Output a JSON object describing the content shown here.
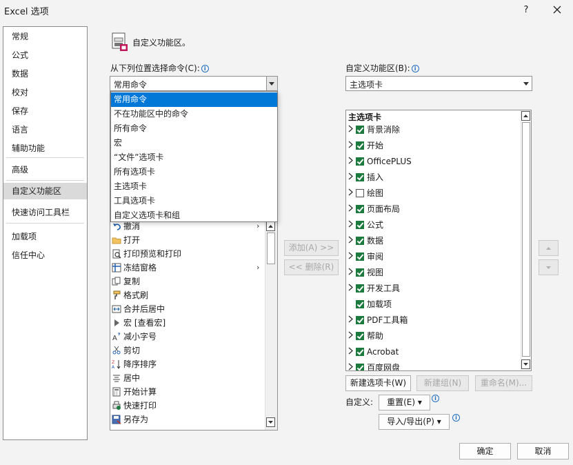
{
  "window": {
    "title": "Excel 选项",
    "help": "?"
  },
  "nav": {
    "items": [
      {
        "label": "常规"
      },
      {
        "label": "公式"
      },
      {
        "label": "数据"
      },
      {
        "label": "校对"
      },
      {
        "label": "保存"
      },
      {
        "label": "语言"
      },
      {
        "label": "辅助功能"
      },
      {
        "label": "高级"
      },
      {
        "label": "自定义功能区",
        "selected": true
      },
      {
        "label": "快速访问工具栏"
      },
      {
        "label": "加载项"
      },
      {
        "label": "信任中心"
      }
    ]
  },
  "header": {
    "text": "自定义功能区。"
  },
  "left": {
    "label": "从下列位置选择命令(C):",
    "combo_value": "常用命令",
    "dropdown_options": [
      {
        "label": "常用命令",
        "selected": true
      },
      {
        "label": "不在功能区中的命令"
      },
      {
        "label": "所有命令"
      },
      {
        "label": "宏"
      },
      {
        "label": "“文件”选项卡"
      },
      {
        "label": "所有选项卡"
      },
      {
        "label": "主选项卡"
      },
      {
        "label": "工具选项卡"
      },
      {
        "label": "自定义选项卡和组"
      }
    ],
    "commands": [
      {
        "label": "撤消",
        "icon": "undo-icon",
        "submenu": true
      },
      {
        "label": "打开",
        "icon": "folder-icon"
      },
      {
        "label": "打印预览和打印",
        "icon": "print-preview-icon"
      },
      {
        "label": "冻结窗格",
        "icon": "freeze-panes-icon",
        "submenu": true
      },
      {
        "label": "复制",
        "icon": "copy-icon"
      },
      {
        "label": "格式刷",
        "icon": "format-painter-icon"
      },
      {
        "label": "合并后居中",
        "icon": "merge-center-icon"
      },
      {
        "label": "宏 [查看宏]",
        "icon": "macro-icon"
      },
      {
        "label": "减小字号",
        "icon": "decrease-font-icon"
      },
      {
        "label": "剪切",
        "icon": "cut-icon"
      },
      {
        "label": "降序排序",
        "icon": "sort-descending-icon"
      },
      {
        "label": "居中",
        "icon": "center-icon"
      },
      {
        "label": "开始计算",
        "icon": "calculate-icon"
      },
      {
        "label": "快速打印",
        "icon": "quick-print-icon"
      },
      {
        "label": "另存为",
        "icon": "save-as-icon"
      }
    ]
  },
  "middle": {
    "add_label": "添加(A) >>",
    "remove_label": "<< 删除(R)"
  },
  "right": {
    "label": "自定义功能区(B):",
    "combo_value": "主选项卡",
    "tree_header": "主选项卡",
    "tabs": [
      {
        "label": "背景消除",
        "checked": true,
        "expandable": true
      },
      {
        "label": "开始",
        "checked": true,
        "expandable": true
      },
      {
        "label": "OfficePLUS",
        "checked": true,
        "expandable": true
      },
      {
        "label": "插入",
        "checked": true,
        "expandable": true
      },
      {
        "label": "绘图",
        "checked": false,
        "expandable": true
      },
      {
        "label": "页面布局",
        "checked": true,
        "expandable": true
      },
      {
        "label": "公式",
        "checked": true,
        "expandable": true
      },
      {
        "label": "数据",
        "checked": true,
        "expandable": true
      },
      {
        "label": "审阅",
        "checked": true,
        "expandable": true
      },
      {
        "label": "视图",
        "checked": true,
        "expandable": true
      },
      {
        "label": "开发工具",
        "checked": true,
        "expandable": true
      },
      {
        "label": "加载项",
        "checked": true,
        "expandable": false
      },
      {
        "label": "PDF工具箱",
        "checked": true,
        "expandable": true
      },
      {
        "label": "帮助",
        "checked": true,
        "expandable": true
      },
      {
        "label": "Acrobat",
        "checked": true,
        "expandable": true
      },
      {
        "label": "百度网盘",
        "checked": true,
        "expandable": true
      }
    ],
    "new_tab_label": "新建选项卡(W)",
    "new_group_label": "新建组(N)",
    "rename_label": "重命名(M)...",
    "customize_label": "自定义:",
    "reset_label": "重置(E) ▾",
    "import_export_label": "导入/导出(P) ▾"
  },
  "footer": {
    "ok_label": "确定",
    "cancel_label": "取消"
  },
  "colors": {
    "accent": "#0078d7",
    "check": "#1d7a3f",
    "selected_nav": "#dadada"
  }
}
